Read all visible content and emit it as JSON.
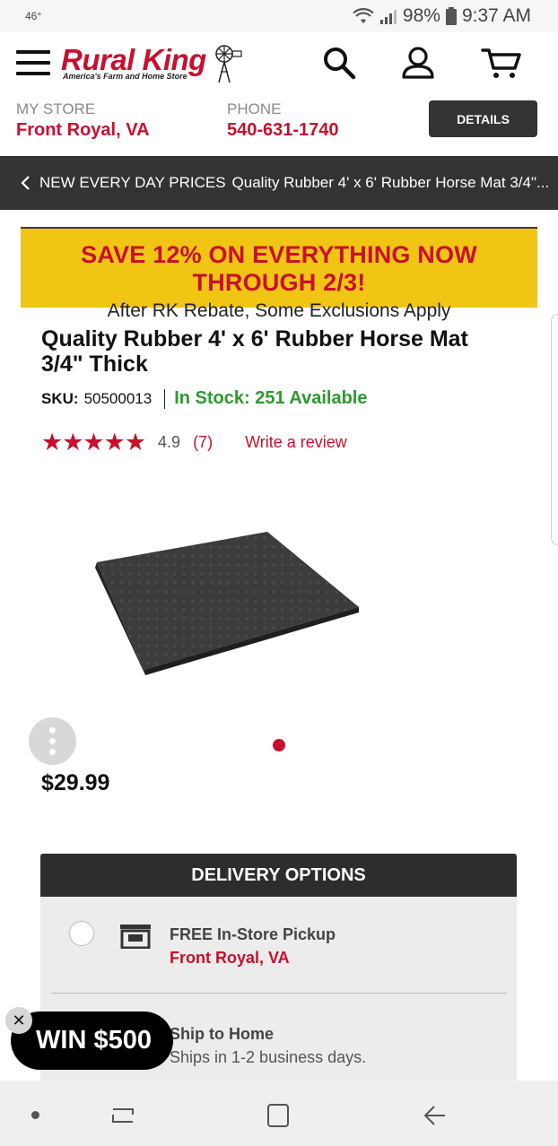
{
  "status_bar": {
    "temperature": "46°",
    "battery": "98%",
    "time": "9:37 AM"
  },
  "header": {
    "brand": "Rural King",
    "tagline": "America's Farm and Home Store",
    "icons": [
      "menu-icon",
      "search-icon",
      "account-icon",
      "cart-icon"
    ]
  },
  "store": {
    "my_store_label": "MY STORE",
    "my_store_value": "Front Royal, VA",
    "phone_label": "PHONE",
    "phone_value": "540-631-1740",
    "details_label": "DETAILS"
  },
  "breadcrumb": {
    "category": "NEW EVERY DAY PRICES",
    "current": "Quality Rubber 4' x 6' Rubber Horse Mat 3/4\"..."
  },
  "promo": {
    "headline": "SAVE 12% ON EVERYTHING NOW THROUGH 2/3!",
    "subline": "After RK Rebate, Some Exclusions Apply"
  },
  "product": {
    "title": "Quality Rubber 4' x 6' Rubber Horse Mat 3/4\" Thick",
    "sku_label": "SKU:",
    "sku": "50500013",
    "stock": "In Stock: 251 Available",
    "stars": "★★★★★",
    "rating": "4.9",
    "review_count": "(7)",
    "write_review": "Write a review",
    "price": "$29.99"
  },
  "delivery": {
    "heading": "DELIVERY OPTIONS",
    "options": [
      {
        "title": "FREE In-Store Pickup",
        "detail": "Front Royal, VA"
      },
      {
        "title": "Ship to Home",
        "detail": "Ships in 1-2 business days."
      }
    ]
  },
  "promo_badge": {
    "label": "WIN $500",
    "close": "✕"
  },
  "colors": {
    "brand_red": "#c8102e",
    "banner_yellow": "#f0c513",
    "stock_green": "#2c9a2c",
    "dark_bar": "#333333"
  }
}
